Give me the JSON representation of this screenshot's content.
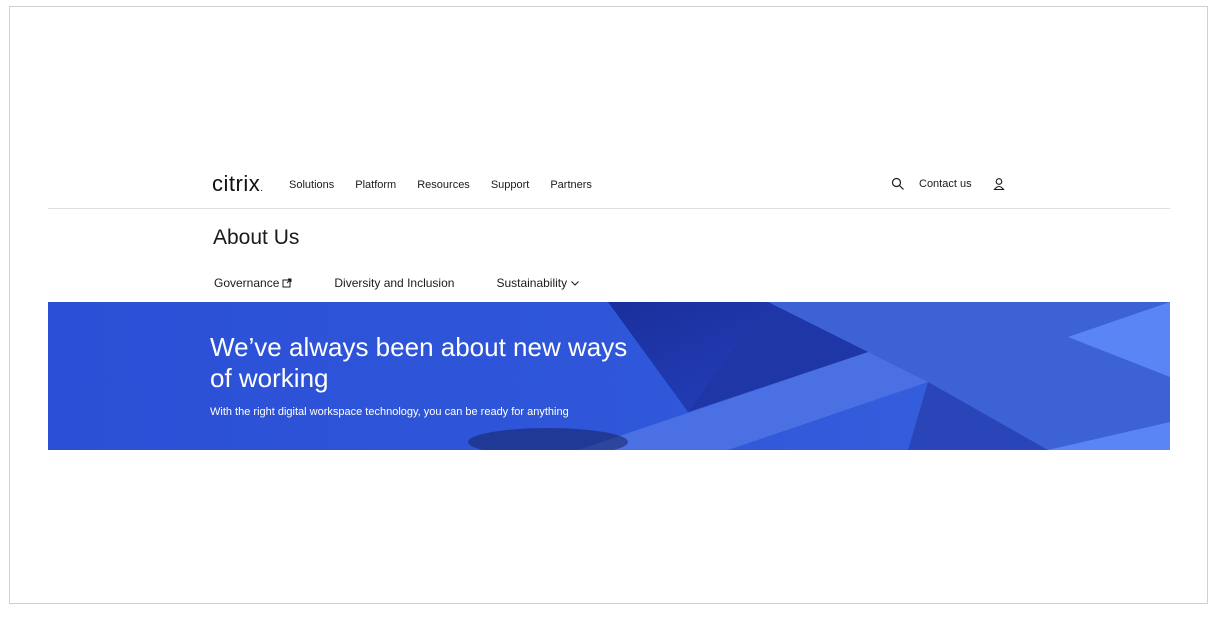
{
  "brand": {
    "logo_text": "citrix"
  },
  "nav": {
    "items": [
      {
        "label": "Solutions"
      },
      {
        "label": "Platform"
      },
      {
        "label": "Resources"
      },
      {
        "label": "Support"
      },
      {
        "label": "Partners"
      }
    ],
    "contact_label": "Contact us",
    "search_icon": "search-icon",
    "user_icon": "user-icon"
  },
  "page": {
    "title": "About Us"
  },
  "subnav": {
    "governance": "Governance",
    "diversity": "Diversity and Inclusion",
    "sustainability": "Sustainability"
  },
  "hero": {
    "title": "We’ve always been about new ways of working",
    "subtitle": "With the right digital workspace technology, you can be ready for anything"
  },
  "colors": {
    "hero_blue": "#2e52d8",
    "hero_dark": "#1d34a8",
    "hero_light": "#4a78f0",
    "text": "#1b1b1b"
  }
}
